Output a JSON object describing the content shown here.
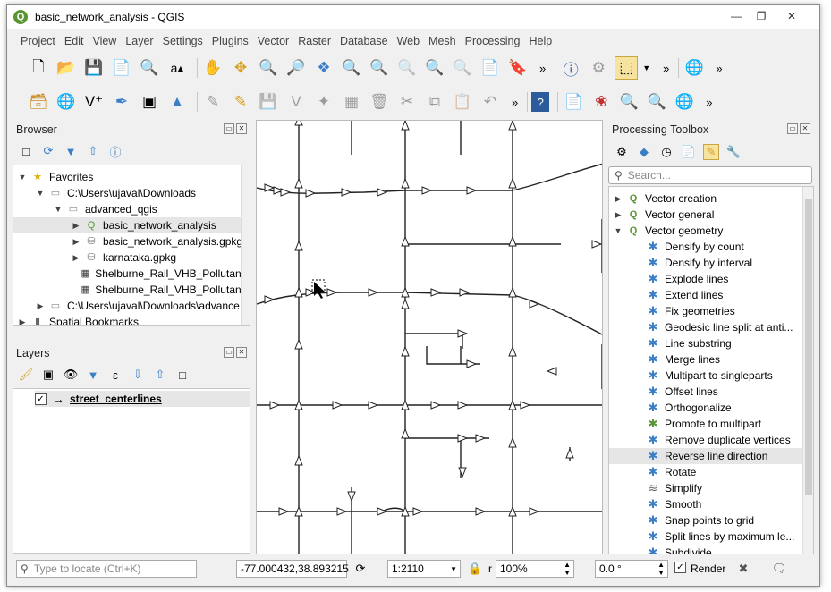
{
  "window": {
    "title": "basic_network_analysis - QGIS"
  },
  "menu": [
    "Project",
    "Edit",
    "View",
    "Layer",
    "Settings",
    "Plugins",
    "Vector",
    "Raster",
    "Database",
    "Web",
    "Mesh",
    "Processing",
    "Help"
  ],
  "browser": {
    "title": "Browser",
    "items": [
      {
        "label": "Favorites",
        "icon": "star-icon"
      },
      {
        "label": "C:\\Users\\ujaval\\Downloads",
        "icon": "folder-icon"
      },
      {
        "label": "advanced_qgis",
        "icon": "folder-icon"
      },
      {
        "label": "basic_network_analysis",
        "icon": "qgis-project-icon"
      },
      {
        "label": "basic_network_analysis.gpkg",
        "icon": "geopackage-icon"
      },
      {
        "label": "karnataka.gpkg",
        "icon": "geopackage-icon"
      },
      {
        "label": "Shelburne_Rail_VHB_PollutantS",
        "icon": "raster-icon"
      },
      {
        "label": "Shelburne_Rail_VHB_PollutantS",
        "icon": "raster-icon"
      },
      {
        "label": "C:\\Users\\ujaval\\Downloads\\advance",
        "icon": "folder-icon"
      },
      {
        "label": "Spatial Bookmarks",
        "icon": "bookmark-icon"
      }
    ]
  },
  "layers": {
    "title": "Layers",
    "items": [
      {
        "label": "street_centerlines",
        "checked": true
      }
    ]
  },
  "toolbox": {
    "title": "Processing Toolbox",
    "search_placeholder": "Search...",
    "groups": [
      {
        "label": "Vector creation"
      },
      {
        "label": "Vector general"
      },
      {
        "label": "Vector geometry"
      }
    ],
    "items": [
      "Densify by count",
      "Densify by interval",
      "Explode lines",
      "Extend lines",
      "Fix geometries",
      "Geodesic line split at anti...",
      "Line substring",
      "Merge lines",
      "Multipart to singleparts",
      "Offset lines",
      "Orthogonalize",
      "Promote to multipart",
      "Remove duplicate vertices",
      "Reverse line direction",
      "Rotate",
      "Simplify",
      "Smooth",
      "Snap points to grid",
      "Split lines by maximum le...",
      "Subdivide"
    ],
    "selected": "Reverse line direction"
  },
  "status": {
    "locate_placeholder": "Type to locate (Ctrl+K)",
    "coordinate_label": "",
    "coordinate": "-77.000432,38.893215",
    "scale_label": "",
    "scale": "1:2110",
    "magnifier_label": "r",
    "magnifier": "100%",
    "rotation_label": "",
    "rotation": "0.0 °",
    "render_label": "Render"
  }
}
